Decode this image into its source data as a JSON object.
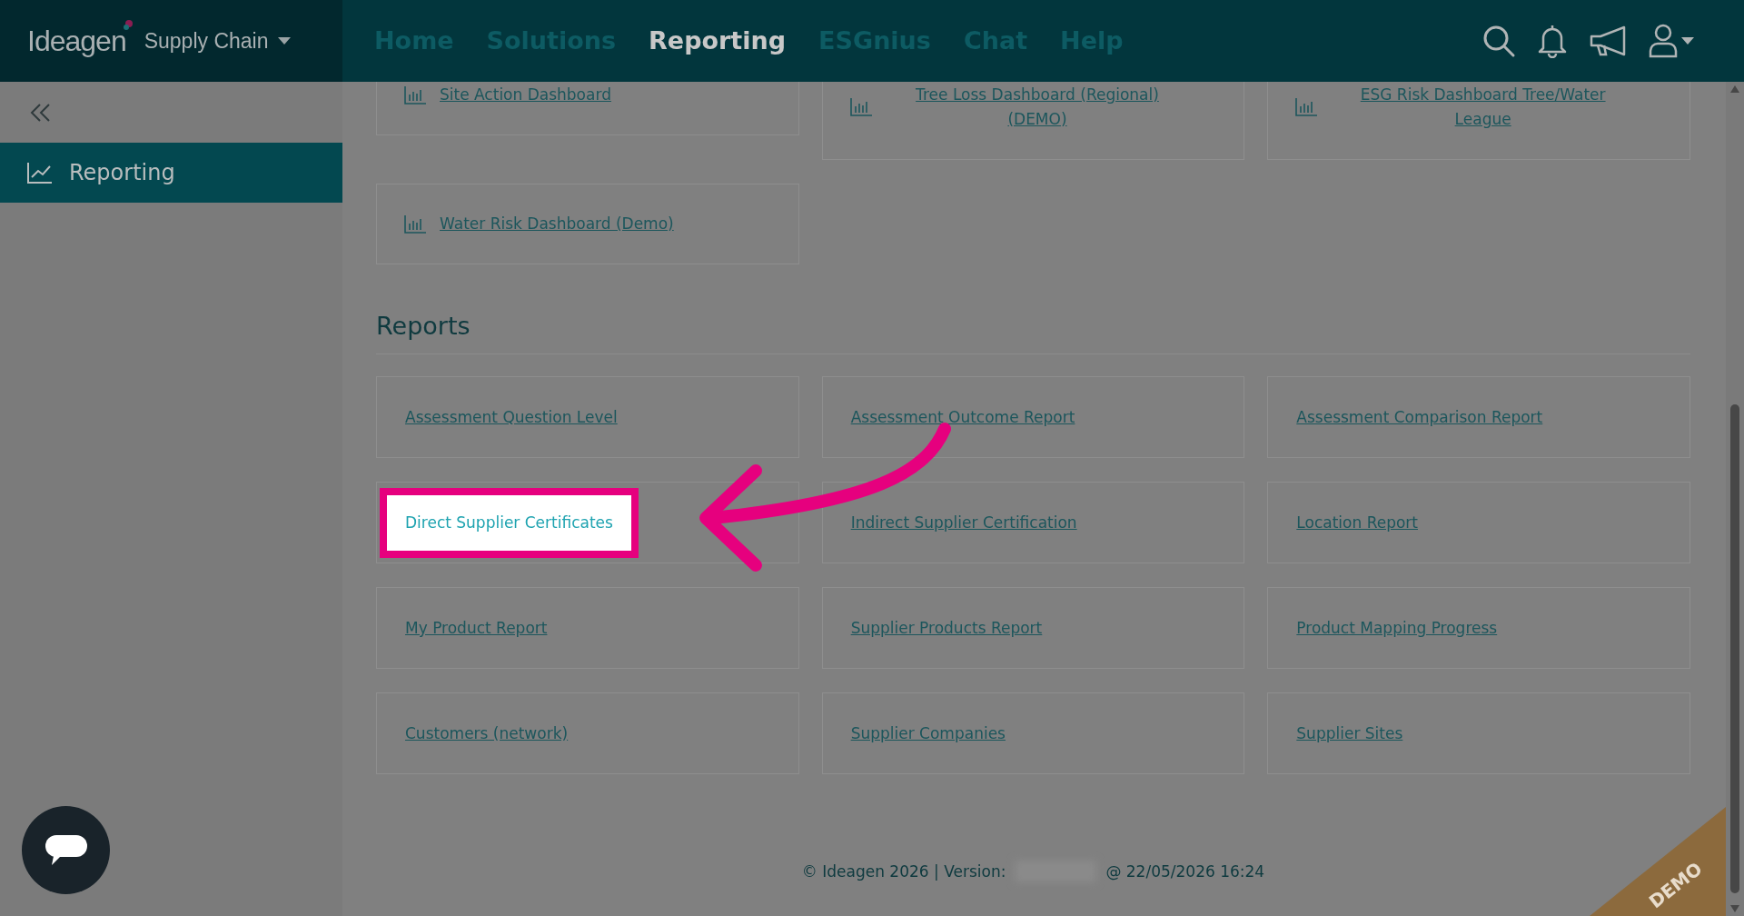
{
  "brand": {
    "name": "Ideagen",
    "product": "Supply Chain"
  },
  "nav": [
    {
      "label": "Home",
      "selected": false
    },
    {
      "label": "Solutions",
      "selected": false
    },
    {
      "label": "Reporting",
      "selected": true
    },
    {
      "label": "ESGnius",
      "selected": false
    },
    {
      "label": "Chat",
      "selected": false
    },
    {
      "label": "Help",
      "selected": false
    }
  ],
  "sidebar": {
    "items": [
      {
        "label": "Reporting",
        "selected": true
      }
    ]
  },
  "dashboards": [
    {
      "label": "Site Action Dashboard"
    },
    {
      "label": "Tree Loss Dashboard (Regional) (DEMO)"
    },
    {
      "label": "ESG Risk Dashboard Tree/Water League"
    },
    {
      "label": "Water Risk Dashboard (Demo)"
    }
  ],
  "reports": {
    "title": "Reports",
    "items": [
      {
        "label": "Assessment Question Level",
        "highlighted": false
      },
      {
        "label": "Assessment Outcome Report",
        "highlighted": false
      },
      {
        "label": "Assessment Comparison Report",
        "highlighted": false
      },
      {
        "label": "Direct Supplier Certificates",
        "highlighted": true
      },
      {
        "label": "Indirect Supplier Certification",
        "highlighted": false
      },
      {
        "label": "Location Report",
        "highlighted": false
      },
      {
        "label": "My Product Report",
        "highlighted": false
      },
      {
        "label": "Supplier Products Report",
        "highlighted": false
      },
      {
        "label": "Product Mapping Progress",
        "highlighted": false
      },
      {
        "label": "Customers (network)",
        "highlighted": false
      },
      {
        "label": "Supplier Companies",
        "highlighted": false
      },
      {
        "label": "Supplier Sites",
        "highlighted": false
      }
    ]
  },
  "footer": {
    "copyright": "© Ideagen 2026 | Version:",
    "timestamp": "@ 22/05/2026 16:24"
  },
  "demo_ribbon": "DEMO"
}
